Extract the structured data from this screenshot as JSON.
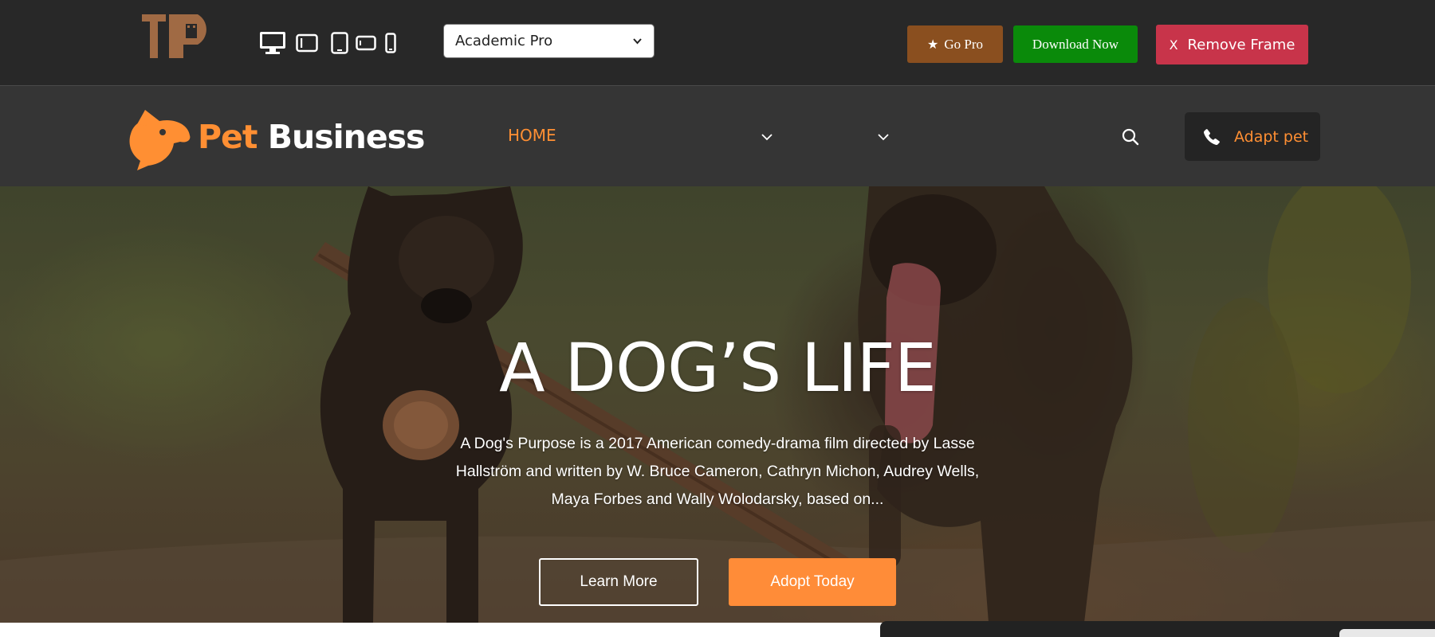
{
  "toolbar": {
    "devices": [
      "desktop-icon",
      "laptop-icon",
      "tablet-icon",
      "tablet-landscape-icon",
      "mobile-icon"
    ],
    "theme_select": {
      "value": "Academic Pro"
    },
    "go_pro_label": "Go Pro",
    "download_label": "Download Now",
    "remove_label": "Remove Frame",
    "remove_mark": "X",
    "colors": {
      "go_pro": "#8a4f1f",
      "download": "#0a8a0a",
      "remove": "#c8344a"
    }
  },
  "header": {
    "brand": {
      "part1": "Pet",
      "part2": "Business"
    },
    "nav": {
      "home": "HOME"
    },
    "adapt_label": "Adapt pet",
    "accent": "#ff8f33"
  },
  "hero": {
    "title": "A DOG’S LIFE",
    "description": "A Dog's Purpose is a 2017 American comedy-drama film directed by Lasse Hallström and written by W. Bruce Cameron, Cathryn Michon, Audrey Wells, Maya Forbes and Wally Wolodarsky, based on...",
    "learn_more_label": "Learn More",
    "adopt_label": "Adopt Today"
  }
}
